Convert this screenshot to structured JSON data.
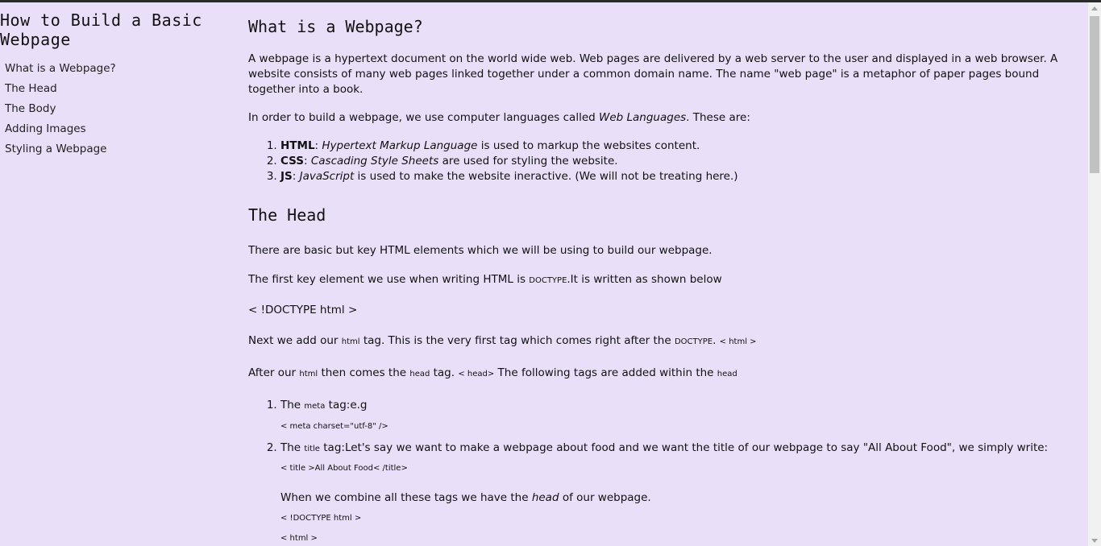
{
  "nav": {
    "title": "How to Build a Basic Webpage",
    "items": [
      {
        "label": "What is a Webpage?"
      },
      {
        "label": "The Head"
      },
      {
        "label": "The Body"
      },
      {
        "label": "Adding Images"
      },
      {
        "label": "Styling a Webpage"
      }
    ]
  },
  "section1": {
    "heading": "What is a Webpage?",
    "p1": "A webpage is a hypertext document on the world wide web. Web pages are delivered by a web server to the user and displayed in a web browser. A website consists of many web pages linked together under a common domain name. The name \"web page\" is a metaphor of paper pages bound together into a book.",
    "p2_before": "In order to build a webpage, we use computer languages called ",
    "p2_em": "Web Languages",
    "p2_after": ". These are:",
    "list": [
      {
        "strong": "HTML",
        "sep": ": ",
        "em": "Hypertext Markup Language",
        "rest": " is used to markup the websites content."
      },
      {
        "strong": "CSS",
        "sep": ": ",
        "em": "Cascading Style Sheets",
        "rest": " are used for styling the website."
      },
      {
        "strong": "JS",
        "sep": ": ",
        "em": "JavaScript",
        "rest": " is used to make the website ineractive. (We will not be treating here.)"
      }
    ]
  },
  "section2": {
    "heading": "The Head",
    "p3": "There are basic but key HTML elements which we will be using to build our webpage.",
    "p4_before": "The first key element we use when writing HTML is ",
    "p4_code": "DOCTYPE",
    "p4_after": ".It is written as shown below",
    "code_doctype": "< !DOCTYPE html >",
    "p5_a": "Next we add our ",
    "p5_code1": "html",
    "p5_b": " tag. This is the very first tag which comes right after the ",
    "p5_code2": "DOCTYPE",
    "p5_c": ". ",
    "p5_code3": "< html >",
    "p6_a": "After our ",
    "p6_code1": "html",
    "p6_b": " then comes the ",
    "p6_code2": "head",
    "p6_c": " tag. ",
    "p6_code3": "< head>",
    "p6_d": " The following tags are added within the ",
    "p6_code4": "head",
    "list": {
      "item1_a": "The ",
      "item1_code": "meta",
      "item1_b": " tag:e.g",
      "item1_snippet": "< meta charset=\"utf-8\" />",
      "item2_a": "The ",
      "item2_code": "title",
      "item2_b": " tag:Let's say we want to make a webpage about food and we want the title of our webpage to say \"All About Food\", we simply write:",
      "item2_snippet": "< title >All About Food< /title>",
      "combine_a": "When we combine all these tags we have the ",
      "combine_em": "head",
      "combine_b": " of our webpage.",
      "snippet_doctype": "< !DOCTYPE html >",
      "snippet_html": "< html >"
    }
  }
}
